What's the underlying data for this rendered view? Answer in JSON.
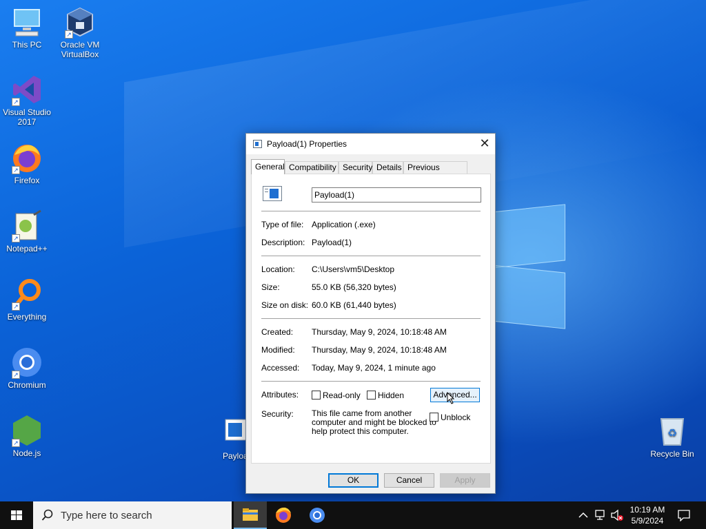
{
  "desktop": {
    "icons": [
      {
        "label": "This PC"
      },
      {
        "label": "Oracle VM VirtualBox"
      },
      {
        "label": "Visual Studio 2017"
      },
      {
        "label": "Firefox"
      },
      {
        "label": "Notepad++"
      },
      {
        "label": "Everything"
      },
      {
        "label": "Chromium"
      },
      {
        "label": "Node.js"
      },
      {
        "label": "Payloa"
      },
      {
        "label": "Recycle Bin"
      }
    ]
  },
  "dialog": {
    "title": "Payload(1) Properties",
    "close_glyph": "✕",
    "tabs": [
      "General",
      "Compatibility",
      "Security",
      "Details",
      "Previous Versions"
    ],
    "active_tab": "General",
    "file_name": "Payload(1)",
    "fields": {
      "type_label": "Type of file:",
      "type_value": "Application (.exe)",
      "description_label": "Description:",
      "description_value": "Payload(1)",
      "location_label": "Location:",
      "location_value": "C:\\Users\\vm5\\Desktop",
      "size_label": "Size:",
      "size_value": "55.0 KB (56,320 bytes)",
      "size_on_disk_label": "Size on disk:",
      "size_on_disk_value": "60.0 KB (61,440 bytes)",
      "created_label": "Created:",
      "created_value": "Thursday, May 9, 2024, 10:18:48 AM",
      "modified_label": "Modified:",
      "modified_value": "Thursday, May 9, 2024, 10:18:48 AM",
      "accessed_label": "Accessed:",
      "accessed_value": "Today, May 9, 2024, 1 minute ago"
    },
    "attributes": {
      "label": "Attributes:",
      "readonly_label": "Read-only",
      "hidden_label": "Hidden",
      "advanced_label": "Advanced..."
    },
    "security": {
      "label": "Security:",
      "line1": "This file came from another",
      "line2": "computer and might be blocked to",
      "line3": "help protect this computer.",
      "unblock_label": "Unblock"
    },
    "buttons": {
      "ok": "OK",
      "cancel": "Cancel",
      "apply": "Apply"
    }
  },
  "taskbar": {
    "search_placeholder": "Type here to search",
    "time": "10:19 AM",
    "date": "5/9/2024"
  },
  "colors": {
    "accent": "#0078d7",
    "taskbar": "#101010",
    "desktop": "#0b63d8"
  }
}
